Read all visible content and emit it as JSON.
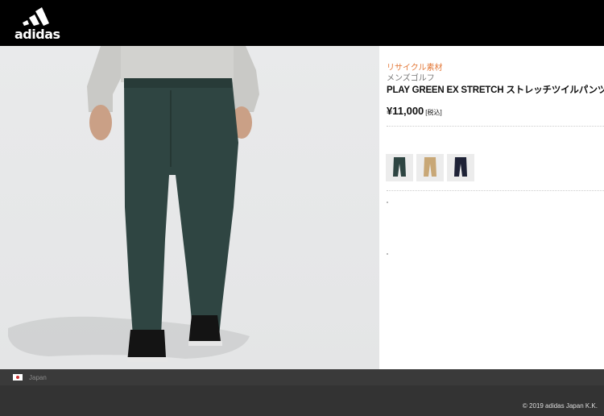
{
  "brand": {
    "name": "adidas",
    "logo_icon": "adidas-three-stripes-icon"
  },
  "product": {
    "tag": "リサイクル素材",
    "category": "メンズゴルフ",
    "name": "PLAY GREEN EX STRETCH ストレッチツイルパンツ",
    "price": "¥11,000",
    "tax_note": "[税込]",
    "colors": [
      {
        "name": "green",
        "hex": "#2e4542",
        "selected": true
      },
      {
        "name": "khaki",
        "hex": "#c8a776",
        "selected": false
      },
      {
        "name": "navy",
        "hex": "#1e2236",
        "selected": false
      }
    ]
  },
  "footer": {
    "country": "Japan",
    "country_icon": "japan-flag-icon",
    "copyright": "© 2019 adidas Japan K.K."
  }
}
